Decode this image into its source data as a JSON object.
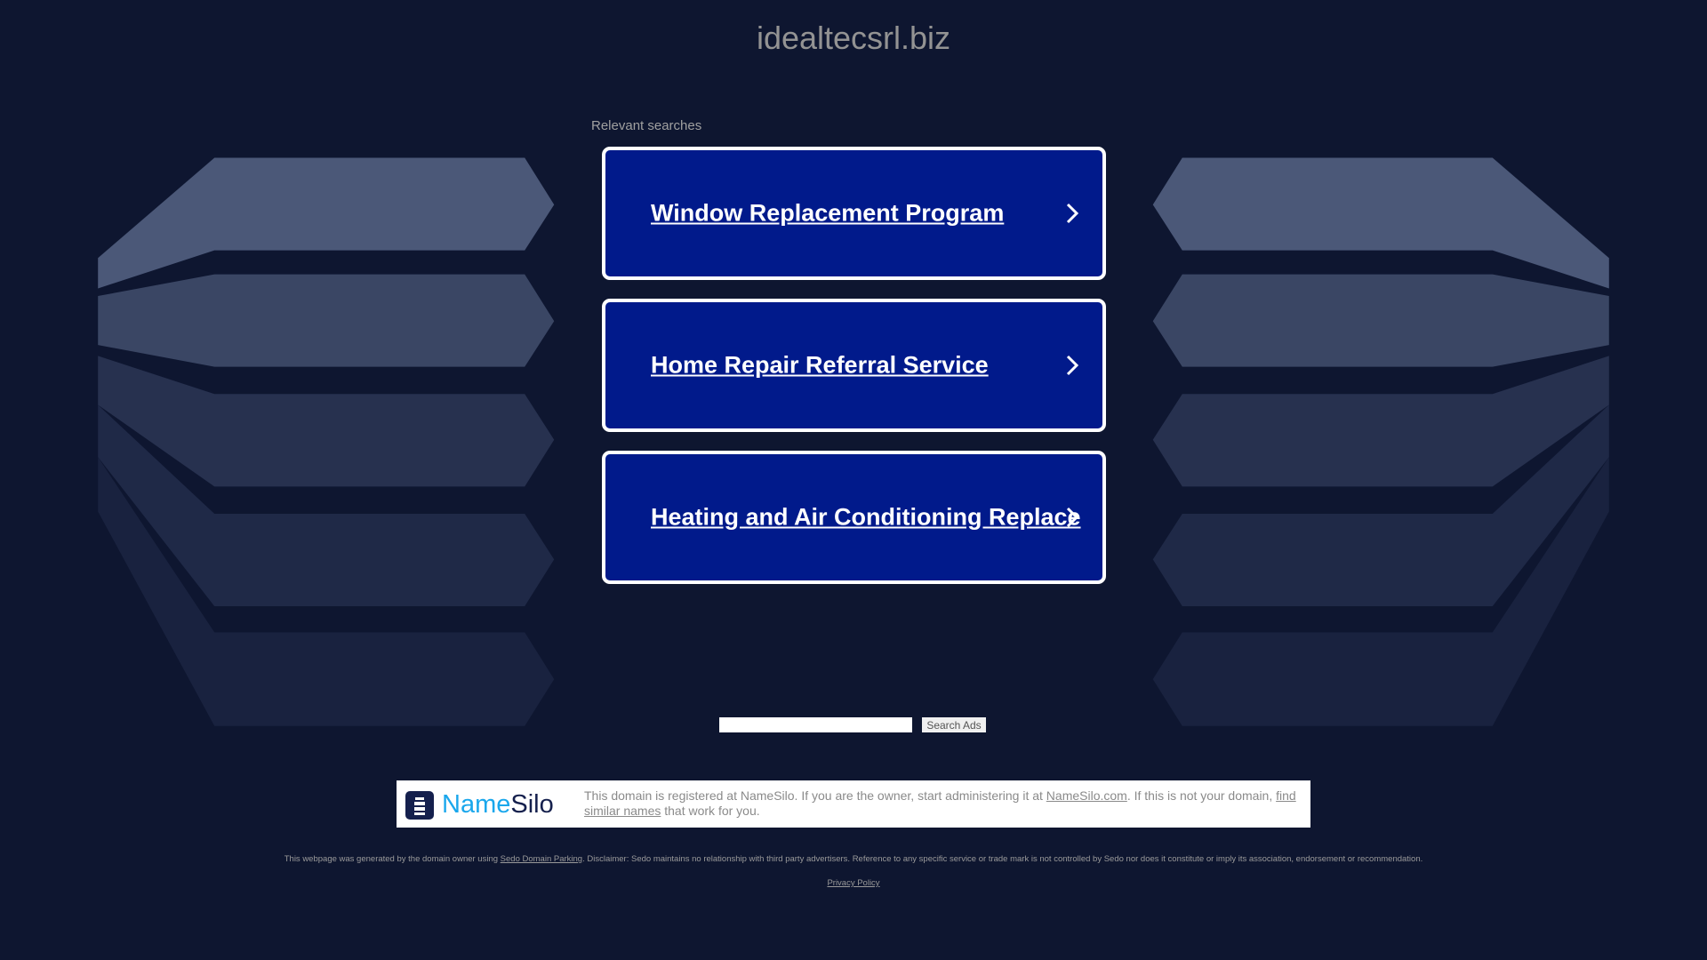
{
  "header": {
    "title": "idealtecsrl.biz"
  },
  "relevant_searches": {
    "heading": "Relevant searches",
    "items": [
      {
        "label": "Window Replacement Program"
      },
      {
        "label": "Home Repair Referral Service"
      },
      {
        "label": "Heating and Air Conditioning Replace"
      }
    ]
  },
  "search": {
    "placeholder": "",
    "button_label": "Search Ads"
  },
  "namesilo": {
    "logo_name": "Name",
    "logo_silo": "Silo",
    "text_1": "This domain is registered at NameSilo. If you are the owner, start administering it at ",
    "link_1": "NameSilo.com",
    "text_2": ". If this is not your domain, ",
    "link_2": "find similar names",
    "text_3": " that work for you."
  },
  "footer": {
    "disclaimer_1": "This webpage was generated by the domain owner using ",
    "sedo_link": "Sedo Domain Parking",
    "disclaimer_2": ". Disclaimer: Sedo maintains no relationship with third party advertisers. Reference to any specific service or trade mark is not controlled by Sedo nor does it constitute or imply its association, endorsement or recommendation.",
    "privacy_policy": "Privacy Policy"
  },
  "colors": {
    "background": "#0e1630",
    "card": "#011a8b",
    "namesilo_blue": "#1aa7ec",
    "namesilo_navy": "#15204d"
  }
}
